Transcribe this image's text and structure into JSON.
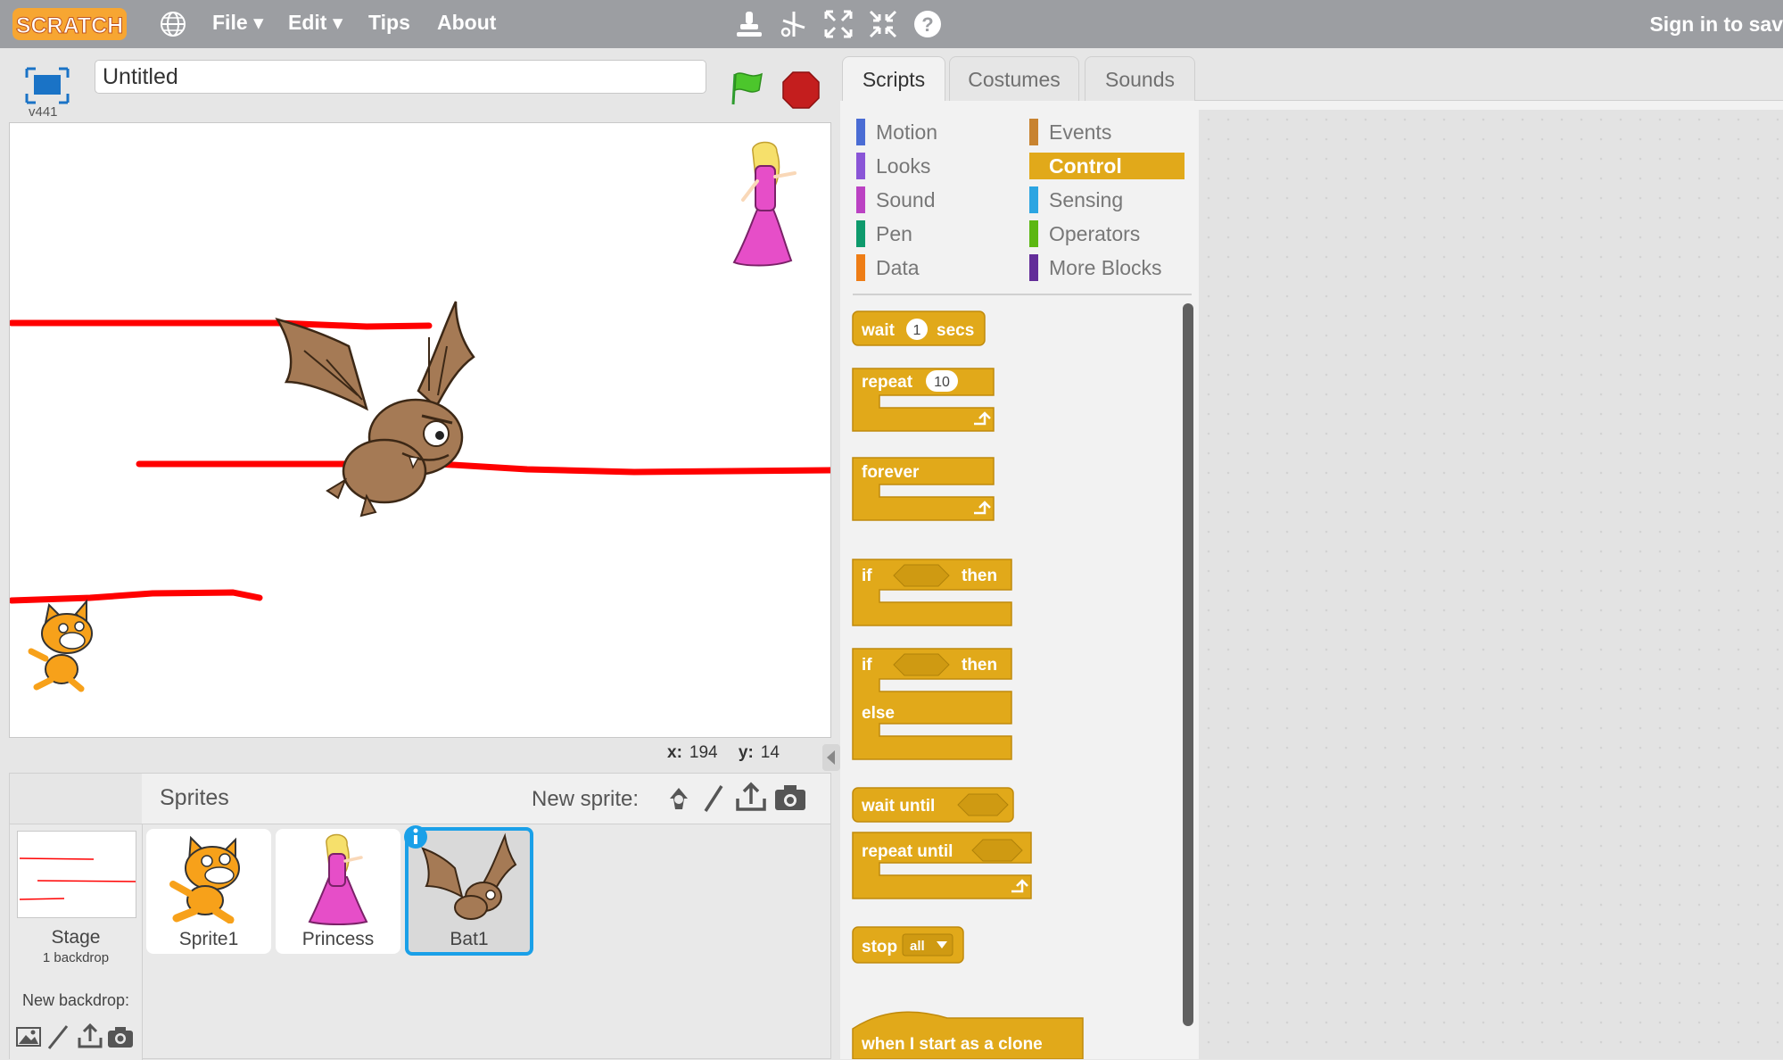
{
  "menu": {
    "logo": "SCRATCH",
    "file": "File ▾",
    "edit": "Edit ▾",
    "tips": "Tips",
    "about": "About",
    "sign_in": "Sign in to sav"
  },
  "project": {
    "title": "Untitled",
    "version": "v441"
  },
  "coords": {
    "x_label": "x:",
    "x_value": "194",
    "y_label": "y:",
    "y_value": "14"
  },
  "tabs": [
    "Scripts",
    "Costumes",
    "Sounds"
  ],
  "active_tab": "Scripts",
  "categories": {
    "left": [
      {
        "label": "Motion",
        "color": "#4a6cd4"
      },
      {
        "label": "Looks",
        "color": "#8a55d7"
      },
      {
        "label": "Sound",
        "color": "#bb42c3"
      },
      {
        "label": "Pen",
        "color": "#0e9a6c"
      },
      {
        "label": "Data",
        "color": "#ee7d16"
      }
    ],
    "right": [
      {
        "label": "Events",
        "color": "#c88330"
      },
      {
        "label": "Control",
        "color": "#e1a91a"
      },
      {
        "label": "Sensing",
        "color": "#2ca5e2"
      },
      {
        "label": "Operators",
        "color": "#5cb712"
      },
      {
        "label": "More Blocks",
        "color": "#632d99"
      }
    ],
    "selected": "Control"
  },
  "blocks": {
    "wait": "wait",
    "wait_value": "1",
    "secs": "secs",
    "repeat": "repeat",
    "repeat_value": "10",
    "forever": "forever",
    "if": "if",
    "then": "then",
    "if2": "if",
    "then2": "then",
    "else": "else",
    "wait_until": "wait  until",
    "repeat_until": "repeat  until",
    "stop": "stop",
    "stop_option": "all",
    "clone": "when I start as a clone"
  },
  "sprites": {
    "header": "Sprites",
    "new_sprite": "New sprite:",
    "items": [
      {
        "name": "Sprite1"
      },
      {
        "name": "Princess"
      },
      {
        "name": "Bat1"
      }
    ],
    "selected": "Bat1"
  },
  "stage_panel": {
    "label": "Stage",
    "backdrops": "1 backdrop",
    "new_backdrop": "New backdrop:"
  },
  "colors": {
    "control": "#e1a91a",
    "menu_bar": "#9c9ea2",
    "selection": "#1aa0e8",
    "pen_line": "#ff0000"
  }
}
